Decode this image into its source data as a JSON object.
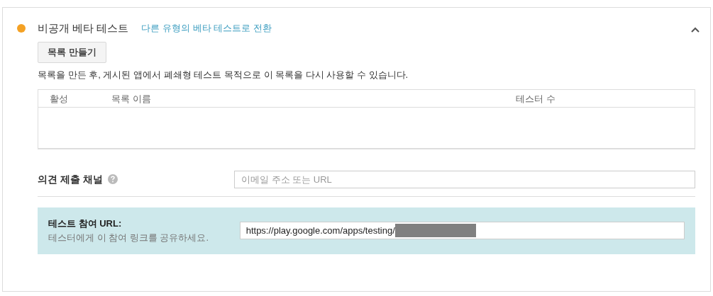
{
  "section": {
    "title": "비공개 베타 테스트",
    "switch_link": "다른 유형의 베타 테스트로 전환",
    "expanded": true,
    "color": "#f4a124"
  },
  "create_button": "목록 만들기",
  "description": "목록을 만든 후, 게시된 앱에서 폐쇄형 테스트 목적으로 이 목록을 다시 사용할 수 있습니다.",
  "table": {
    "columns": [
      "활성",
      "목록 이름",
      "테스터 수"
    ]
  },
  "feedback": {
    "label": "의견 제출 채널",
    "placeholder": "이메일 주소 또는 URL"
  },
  "opt_in": {
    "label": "테스트 참여 URL:",
    "hint": "테스터에게 이 참여 링크를 공유하세요.",
    "value": "https://play.google.com/apps/testing/",
    "redacted": true
  }
}
